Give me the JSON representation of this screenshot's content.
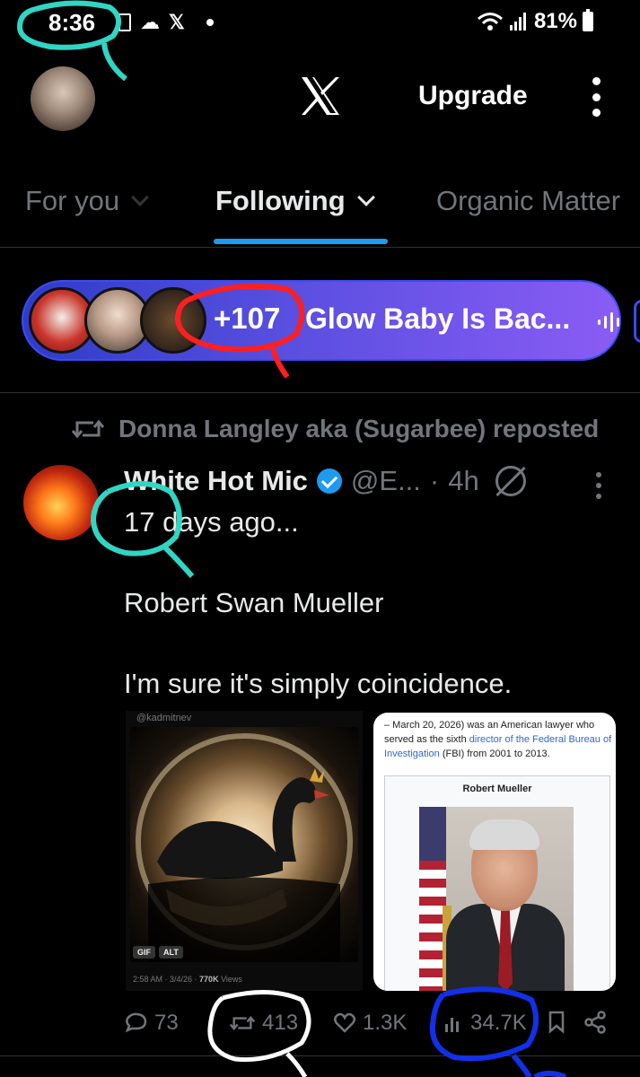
{
  "status_bar": {
    "time": "8:36",
    "battery": "81%",
    "icons": [
      "sim-icon",
      "cloud-icon",
      "x-app-icon",
      "dot-icon",
      "wifi-icon",
      "signal-icon",
      "battery-icon"
    ]
  },
  "header": {
    "upgrade_label": "Upgrade"
  },
  "tabs": [
    {
      "label": "For you"
    },
    {
      "label": "Following"
    },
    {
      "label": "Organic Matter"
    }
  ],
  "spaces_pill": {
    "count": "+107",
    "separator": "·",
    "title": "Glow Baby Is Bac..."
  },
  "tweet": {
    "repost_label": "Donna Langley aka (Sugarbee) reposted",
    "author_name": "White Hot Mic",
    "handle": "@E...",
    "dot": "·",
    "time_ago": "4h",
    "lines": [
      "17 days ago...",
      "Robert Swan Mueller",
      "I'm sure it's simply coincidence."
    ],
    "media_left": {
      "handle": "@kadmitnev",
      "badges": [
        "GIF",
        "ALT"
      ],
      "meta_time": "2:58 AM · 3/4/26 · ",
      "meta_views": "770K",
      "meta_views_suffix": " Views"
    },
    "media_right": {
      "text_before_link": "– March 20, 2026) was an American lawyer who served as the sixth ",
      "link": "director of the Federal Bureau of Investigation",
      "text_after_link": " (FBI) from 2001 to 2013.",
      "infobox_title": "Robert Mueller"
    },
    "actions": {
      "replies": "73",
      "reposts": "413",
      "likes": "1.3K",
      "views": "34.7K"
    }
  },
  "colors": {
    "accent": "#1d9bf0",
    "muted": "#71767b",
    "annotation_teal": "#2fd6c4",
    "annotation_red": "#ff1f1f",
    "annotation_white": "#ffffff",
    "annotation_blue": "#1230e8"
  }
}
